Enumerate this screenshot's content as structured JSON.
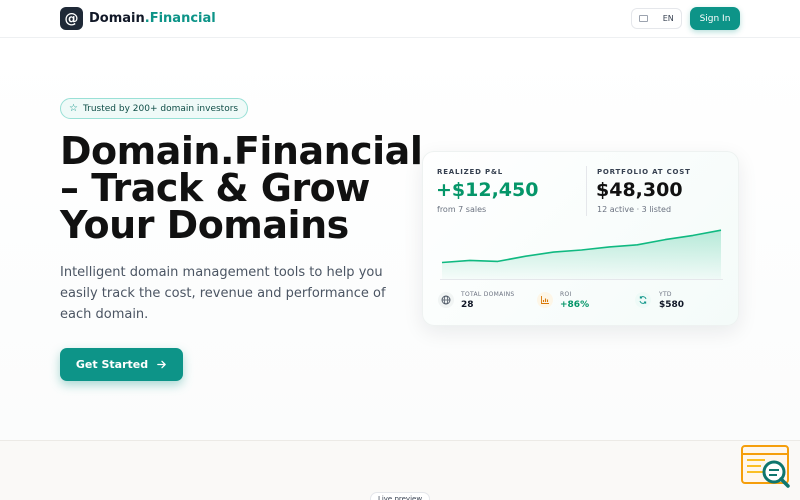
{
  "header": {
    "logo_symbol": "@",
    "brand_main": "Domain",
    "brand_accent": ".Financial",
    "lang_label": "EN",
    "signin_label": "Sign In"
  },
  "hero": {
    "badge_text": "Trusted by 200+ domain investors",
    "title": "Domain.Financial – Track & Grow Your Domains",
    "subtitle": "Intelligent domain management tools to help you easily track the cost, revenue and performance of each domain.",
    "cta_label": "Get Started",
    "cta_icon": "arrow-right-icon"
  },
  "card": {
    "realized_label": "REALIZED P&L",
    "realized_value": "+$12,450",
    "realized_sub": "from 7 sales",
    "portfolio_label": "PORTFOLIO AT COST",
    "portfolio_value": "$48,300",
    "portfolio_sub": "12 active · 3 listed",
    "trend": [
      0.26,
      0.3,
      0.28,
      0.38,
      0.46,
      0.5,
      0.56,
      0.6,
      0.7,
      0.78,
      0.88
    ],
    "stats": [
      {
        "label": "TOTAL DOMAINS",
        "value": "28",
        "icon": "globe-icon"
      },
      {
        "label": "ROI",
        "value": "+86%",
        "icon": "bar-chart-icon"
      },
      {
        "label": "YTD",
        "value": "$580",
        "icon": "refresh-icon"
      }
    ]
  },
  "lower": {
    "live_pill": "Live preview"
  },
  "colors": {
    "accent": "#0d9488",
    "positive": "#059669",
    "text_dark": "#111827"
  }
}
